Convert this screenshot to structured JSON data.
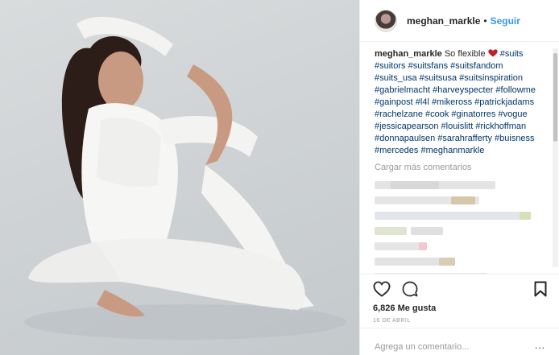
{
  "header": {
    "username": "meghan_markle",
    "separator": "•",
    "follow_label": "Seguir"
  },
  "caption": {
    "username": "meghan_markle",
    "text": "So flexible",
    "hashtags": "#suits #suitors #suitsfans #suitsfandom #suits_usa #suitsusa #suitsinspiration #gabrielmacht #harveyspecter #followme #gainpost #l4l #mikeross #patrickjadams #rachelzane #cook #ginatorres #vogue #jessicapearson #louislitt #rickhoffman #donnapaulsen #sarahrafferty #buisness #mercedes #meghanmarkle"
  },
  "load_more_label": "Cargar más comentarios",
  "likes_text": "6,826 Me gusta",
  "date_text": "16 DE ABRIL",
  "comment_input": {
    "placeholder": "Agrega un comentario...",
    "options_label": "..."
  },
  "colors": {
    "link": "#003569",
    "follow": "#3897f0",
    "heart_emoji": "#c0202a"
  },
  "icons": [
    "heart-icon",
    "comment-icon",
    "bookmark-icon",
    "red-heart-emoji"
  ]
}
